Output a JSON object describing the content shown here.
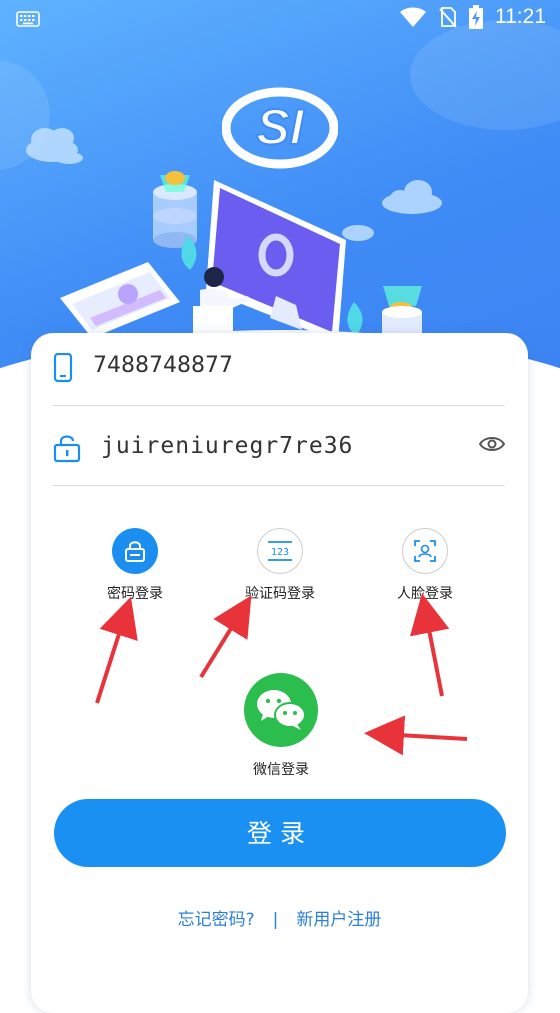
{
  "status_bar": {
    "time": "11:21",
    "icons": [
      "keyboard-icon",
      "wifi-icon",
      "no-sim-icon",
      "battery-charging-icon"
    ]
  },
  "header": {
    "logo_icon": "si-logo-icon"
  },
  "form": {
    "phone": {
      "value": "7488748877",
      "icon": "phone-icon"
    },
    "password": {
      "value": "juireniuregr7re36",
      "icon": "lock-icon",
      "toggle_icon": "eye-icon"
    }
  },
  "login_methods": [
    {
      "label": "密码登录",
      "icon": "lock-icon",
      "active": true
    },
    {
      "label": "验证码登录",
      "icon": "code-123-icon",
      "active": false
    },
    {
      "label": "人脸登录",
      "icon": "face-scan-icon",
      "active": false
    }
  ],
  "wechat": {
    "label": "微信登录",
    "icon": "wechat-icon"
  },
  "login_button": {
    "label": "登录"
  },
  "footer": {
    "forgot_password": "忘记密码?",
    "separator": "|",
    "register": "新用户注册"
  },
  "colors": {
    "primary": "#1a90f2",
    "hero_top": "#5fb2ff",
    "hero_bottom": "#3c82f2",
    "wechat_green": "#2bbd4e",
    "annotation_arrow": "#e8333b",
    "link": "#2b7fd8"
  }
}
